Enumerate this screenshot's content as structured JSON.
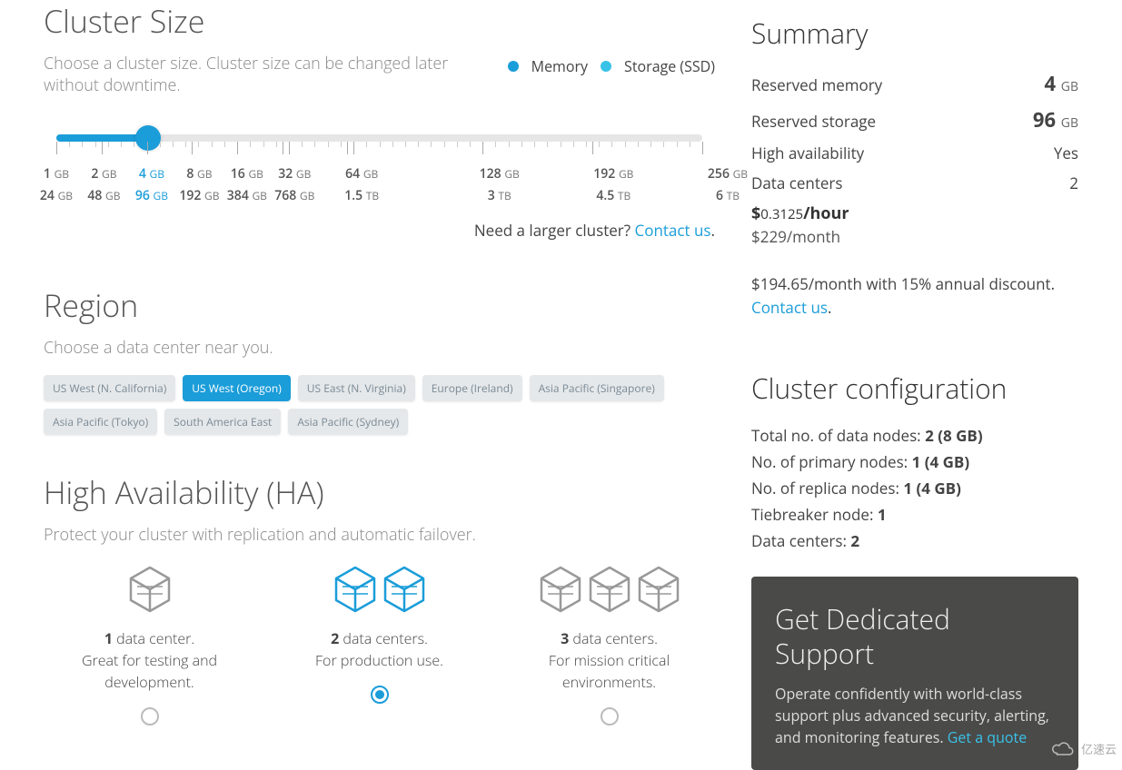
{
  "clusterSize": {
    "title": "Cluster Size",
    "subtitle": "Choose a cluster size. Cluster size can be changed later without downtime.",
    "legend": {
      "memory": "Memory",
      "storage": "Storage (SSD)"
    },
    "selectedIndex": 2,
    "memoryScale": [
      {
        "v": "1",
        "u": "GB",
        "pct": 0
      },
      {
        "v": "2",
        "u": "GB",
        "pct": 7.1
      },
      {
        "v": "4",
        "u": "GB",
        "pct": 14.2,
        "hl": true
      },
      {
        "v": "8",
        "u": "GB",
        "pct": 21.3
      },
      {
        "v": "16",
        "u": "GB",
        "pct": 28.4
      },
      {
        "v": "32",
        "u": "GB",
        "pct": 35.5
      },
      {
        "v": "64",
        "u": "GB",
        "pct": 45.5
      },
      {
        "v": "128",
        "u": "GB",
        "pct": 66
      },
      {
        "v": "192",
        "u": "GB",
        "pct": 83
      },
      {
        "v": "256",
        "u": "GB",
        "pct": 100
      }
    ],
    "storageScale": [
      {
        "v": "24",
        "u": "GB",
        "pct": 0
      },
      {
        "v": "48",
        "u": "GB",
        "pct": 7.1
      },
      {
        "v": "96",
        "u": "GB",
        "pct": 14.2,
        "hl": true
      },
      {
        "v": "192",
        "u": "GB",
        "pct": 21.3
      },
      {
        "v": "384",
        "u": "GB",
        "pct": 28.4
      },
      {
        "v": "768",
        "u": "GB",
        "pct": 35.5
      },
      {
        "v": "1.5",
        "u": "TB",
        "pct": 45.5
      },
      {
        "v": "3",
        "u": "TB",
        "pct": 66
      },
      {
        "v": "4.5",
        "u": "TB",
        "pct": 83
      },
      {
        "v": "6",
        "u": "TB",
        "pct": 100
      }
    ],
    "needLarger": "Need a larger cluster? ",
    "contactUs": "Contact us",
    "dot": "."
  },
  "region": {
    "title": "Region",
    "subtitle": "Choose a data center near you.",
    "options": [
      {
        "label": "US West (N. California)",
        "active": false
      },
      {
        "label": "US West (Oregon)",
        "active": true
      },
      {
        "label": "US East (N. Virginia)",
        "active": false
      },
      {
        "label": "Europe (Ireland)",
        "active": false
      },
      {
        "label": "Asia Pacific (Singapore)",
        "active": false
      },
      {
        "label": "Asia Pacific (Tokyo)",
        "active": false
      },
      {
        "label": "South America East",
        "active": false
      },
      {
        "label": "Asia Pacific (Sydney)",
        "active": false
      }
    ]
  },
  "ha": {
    "title": "High Availability (HA)",
    "subtitle": "Protect your cluster with replication and automatic failover.",
    "options": [
      {
        "count": "1",
        "label": " data center.",
        "sub": "Great for testing and development.",
        "selected": false,
        "cubes": 1,
        "active": false
      },
      {
        "count": "2",
        "label": " data centers.",
        "sub": "For production use.",
        "selected": true,
        "cubes": 2,
        "active": true
      },
      {
        "count": "3",
        "label": " data centers.",
        "sub": "For mission critical environments.",
        "selected": false,
        "cubes": 3,
        "active": false
      }
    ]
  },
  "summary": {
    "title": "Summary",
    "rows": {
      "memLabel": "Reserved memory",
      "memVal": "4",
      "memUnit": "GB",
      "stoLabel": "Reserved storage",
      "stoVal": "96",
      "stoUnit": "GB",
      "haLabel": "High availability",
      "haVal": "Yes",
      "dcLabel": "Data centers",
      "dcVal": "2"
    },
    "price": {
      "cur": "$",
      "hourly": "0.3125",
      "hourSuffix": "/hour",
      "monthly": "229",
      "monthSuffix": "/month"
    },
    "discount": {
      "pre": "$",
      "amount": "194.65",
      "text": "/month with 15% annual discount. ",
      "contact": "Contact us",
      "dot": "."
    }
  },
  "config": {
    "title": "Cluster configuration",
    "lines": {
      "l1a": "Total no. of data nodes: ",
      "l1b": "2 (8 GB)",
      "l2a": "No. of primary nodes: ",
      "l2b": "1 (4 GB)",
      "l3a": "No. of replica nodes: ",
      "l3b": "1 (4 GB)",
      "l4a": "Tiebreaker node: ",
      "l4b": "1",
      "l5a": "Data centers: ",
      "l5b": "2"
    }
  },
  "support": {
    "title": "Get Dedicated Support",
    "body": "Operate confidently with world-class support plus advanced security, alerting, and monitoring features. ",
    "cta": "Get a quote"
  },
  "watermark": "亿速云"
}
